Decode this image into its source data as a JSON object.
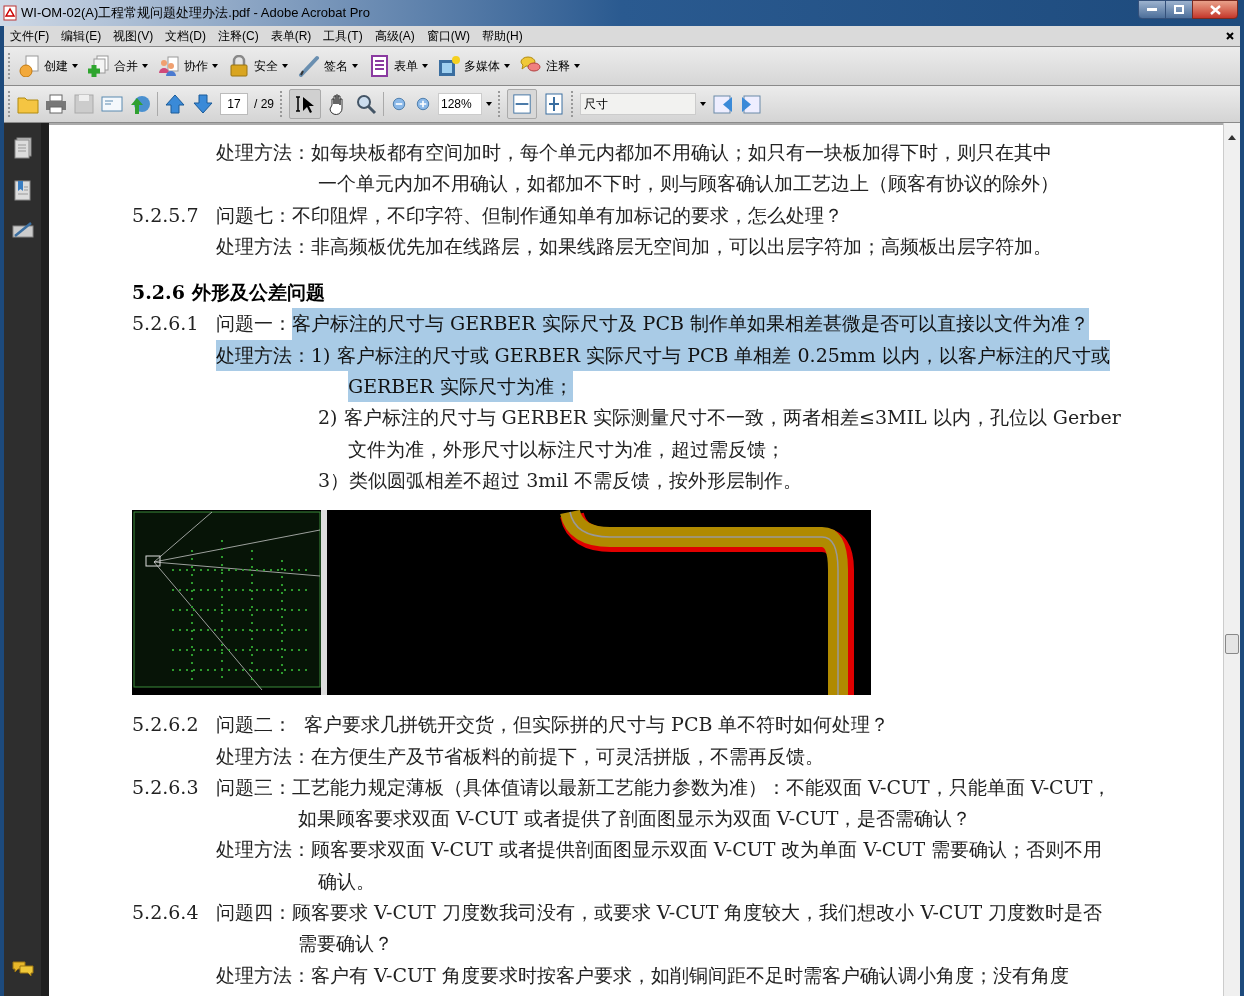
{
  "window": {
    "title": "WI-OM-02(A)工程常规问题处理办法.pdf - Adobe Acrobat Pro"
  },
  "menu": [
    "文件(F)",
    "编辑(E)",
    "视图(V)",
    "文档(D)",
    "注释(C)",
    "表单(R)",
    "工具(T)",
    "高级(A)",
    "窗口(W)",
    "帮助(H)"
  ],
  "task_toolbar": [
    {
      "kind": "create",
      "label": "创建"
    },
    {
      "kind": "merge",
      "label": "合并"
    },
    {
      "kind": "collab",
      "label": "协作"
    },
    {
      "kind": "secure",
      "label": "安全"
    },
    {
      "kind": "sign",
      "label": "签名"
    },
    {
      "kind": "form",
      "label": "表单"
    },
    {
      "kind": "media",
      "label": "多媒体"
    },
    {
      "kind": "comment",
      "label": "注释"
    }
  ],
  "nav_toolbar": {
    "page": "17",
    "page_count": "/ 29",
    "zoom": "128%",
    "find": "尺寸"
  },
  "document": [
    {
      "kind": "answer",
      "text": "处理方法：如每块板都有空间加时，每个单元内都加不用确认；如只有一块板加得下时，则只在其中",
      "selected": false
    },
    {
      "kind": "awrap",
      "text": "一个单元内加不用确认，如都加不下时，则与顾客确认加工艺边上（顾客有协议的除外）",
      "selected": false
    },
    {
      "kind": "item",
      "number": "5.2.5.7",
      "label": "问题七：",
      "text": "不印阻焊，不印字符、但制作通知单有加标记的要求，怎么处理？",
      "selected": false
    },
    {
      "kind": "answer",
      "text": "处理方法：非高频板优先加在线路层，如果线路层无空间加，可以出层字符加；高频板出层字符加。",
      "selected": false
    },
    {
      "kind": "heading",
      "text": "5.2.6 外形及公差问题"
    },
    {
      "kind": "item",
      "number": "5.2.6.1",
      "label": "问题一：",
      "text": "客户标注的尺寸与 GERBER 实际尺寸及 PCB 制作单如果相差甚微是否可以直接以文件为准？",
      "selected": true
    },
    {
      "kind": "answer",
      "text": "处理方法：1) 客户标注的尺寸或 GERBER 实际尺寸与 PCB 单相差 0.25mm 以内，以客户标注的尺寸或",
      "selected": true
    },
    {
      "kind": "swrap",
      "text": "GERBER 实际尺寸为准；",
      "selected": true
    },
    {
      "kind": "subitem",
      "text": "2) 客户标注的尺寸与 GERBER 实际测量尺寸不一致，两者相差≤3MIL 以内，孔位以 Gerber",
      "selected": false
    },
    {
      "kind": "swrap",
      "text": "文件为准，外形尺寸以标注尺寸为准，超过需反馈；",
      "selected": false
    },
    {
      "kind": "subitem",
      "text": "3）类似圆弧相差不超过 3mil 不需反馈，按外形层制作。",
      "selected": false
    },
    {
      "kind": "figure"
    },
    {
      "kind": "item",
      "number": "5.2.6.2",
      "label": "问题二：",
      "text": "  客户要求几拼铣开交货，但实际拼的尺寸与 PCB 单不符时如何处理？",
      "selected": false
    },
    {
      "kind": "answer",
      "text": "处理方法：在方便生产及节省板料的前提下，可灵活拼版，不需再反馈。",
      "selected": false
    },
    {
      "kind": "item",
      "number": "5.2.6.3",
      "label": "问题三：",
      "text": "工艺能力规定薄板（具体值请以最新工艺能力参数为准）：不能双面 V-CUT，只能单面 V-CUT，",
      "selected": false
    },
    {
      "kind": "qwrap",
      "text": "如果顾客要求双面 V-CUT 或者提供了剖面图显示为双面 V-CUT，是否需确认？",
      "selected": false
    },
    {
      "kind": "answer",
      "text": "处理方法：顾客要求双面 V-CUT 或者提供剖面图显示双面 V-CUT 改为单面 V-CUT 需要确认；否则不用",
      "selected": false
    },
    {
      "kind": "awrap",
      "text": "确认。",
      "selected": false
    },
    {
      "kind": "item",
      "number": "5.2.6.4",
      "label": "问题四：",
      "text": "顾客要求 V-CUT 刀度数我司没有，或要求 V-CUT 角度较大，我们想改小 V-CUT 刀度数时是否",
      "selected": false
    },
    {
      "kind": "qwrap",
      "text": "需要确认？",
      "selected": false
    },
    {
      "kind": "answer",
      "text": "处理方法：客户有 V-CUT 角度要求时按客户要求，如削铜间距不足时需客户确认调小角度；没有角度",
      "selected": false
    }
  ]
}
